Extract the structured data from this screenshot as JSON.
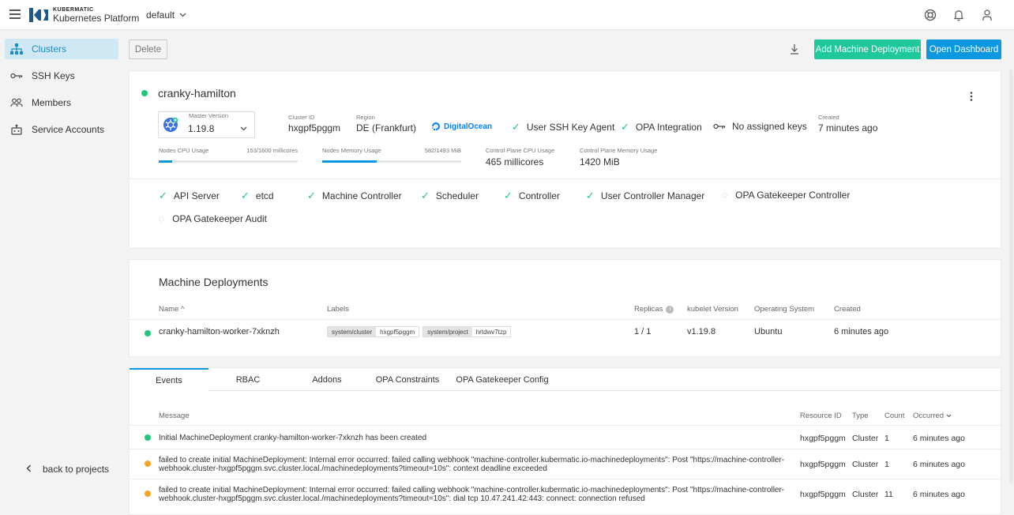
{
  "brand": {
    "line1": "KUBERMATIC",
    "line2": "Kubernetes Platform"
  },
  "project": {
    "selected": "default"
  },
  "sidebar": {
    "items": [
      {
        "label": "Clusters"
      },
      {
        "label": "SSH Keys"
      },
      {
        "label": "Members"
      },
      {
        "label": "Service Accounts"
      }
    ],
    "back": "back to projects"
  },
  "toolbar": {
    "delete_label": "Delete",
    "add_md_label": "Add Machine Deployment",
    "open_dashboard_label": "Open Dashboard"
  },
  "cluster": {
    "name": "cranky-hamilton",
    "master_version_label": "Master Version",
    "master_version": "1.19.8",
    "cluster_id_label": "Cluster ID",
    "cluster_id": "hxgpf5pggm",
    "region_label": "Region",
    "region": "DE (Frankfurt)",
    "provider": "DigitalOcean",
    "ssh_agent": "User SSH Key Agent",
    "opa": "OPA Integration",
    "keys": "No assigned keys",
    "created_label": "Created",
    "created": "7 minutes ago",
    "cpu_label": "Nodes CPU Usage",
    "cpu_value": "153/1600 millicores",
    "cpu_fraction": 0.096,
    "mem_label": "Nodes Memory Usage",
    "mem_value": "582/1493 MiB",
    "mem_fraction": 0.39,
    "cp_cpu_label": "Control Plane CPU Usage",
    "cp_cpu": "465 millicores",
    "cp_mem_label": "Control Plane Memory Usage",
    "cp_mem": "1420 MiB",
    "health": [
      {
        "label": "API Server",
        "state": "ok"
      },
      {
        "label": "etcd",
        "state": "ok"
      },
      {
        "label": "Machine Controller",
        "state": "ok"
      },
      {
        "label": "Scheduler",
        "state": "ok"
      },
      {
        "label": "Controller",
        "state": "ok"
      },
      {
        "label": "User Controller Manager",
        "state": "ok"
      },
      {
        "label": "OPA Gatekeeper Controller",
        "state": "pending"
      },
      {
        "label": "OPA Gatekeeper Audit",
        "state": "pending"
      }
    ]
  },
  "machine_deployments": {
    "title": "Machine Deployments",
    "headers": {
      "name": "Name ^",
      "labels": "Labels",
      "replicas": "Replicas",
      "kubelet": "kubelet Version",
      "os": "Operating System",
      "created": "Created"
    },
    "rows": [
      {
        "name": "cranky-hamilton-worker-7xknzh",
        "labels": [
          {
            "k": "system/cluster",
            "v": "hxgpf5pggm"
          },
          {
            "k": "system/project",
            "v": "hrtdwv7tzp"
          }
        ],
        "replicas": "1 / 1",
        "kubelet": "v1.19.8",
        "os": "Ubuntu",
        "created": "6 minutes ago"
      }
    ]
  },
  "events": {
    "tabs": [
      "Events",
      "RBAC",
      "Addons",
      "OPA Constraints",
      "OPA Gatekeeper Config"
    ],
    "headers": {
      "message": "Message",
      "resource": "Resource ID",
      "type": "Type",
      "count": "Count",
      "occurred": "Occurred"
    },
    "rows": [
      {
        "status": "green",
        "message": "Initial MachineDeployment cranky-hamilton-worker-7xknzh has been created",
        "resource": "hxgpf5pggm",
        "type": "Cluster",
        "count": "1",
        "occurred": "6 minutes ago"
      },
      {
        "status": "orange",
        "message": "failed to create initial MachineDeployment: Internal error occurred: failed calling webhook \"machine-controller.kubermatic.io-machinedeployments\": Post \"https://machine-controller-webhook.cluster-hxgpf5pggm.svc.cluster.local./machinedeployments?timeout=10s\": context deadline exceeded",
        "resource": "hxgpf5pggm",
        "type": "Cluster",
        "count": "1",
        "occurred": "6 minutes ago"
      },
      {
        "status": "orange",
        "message": "failed to create initial MachineDeployment: Internal error occurred: failed calling webhook \"machine-controller.kubermatic.io-machinedeployments\": Post \"https://machine-controller-webhook.cluster-hxgpf5pggm.svc.cluster.local./machinedeployments?timeout=10s\": dial tcp 10.47.241.42:443: connect: connection refused",
        "resource": "hxgpf5pggm",
        "type": "Cluster",
        "count": "11",
        "occurred": "6 minutes ago"
      }
    ]
  }
}
